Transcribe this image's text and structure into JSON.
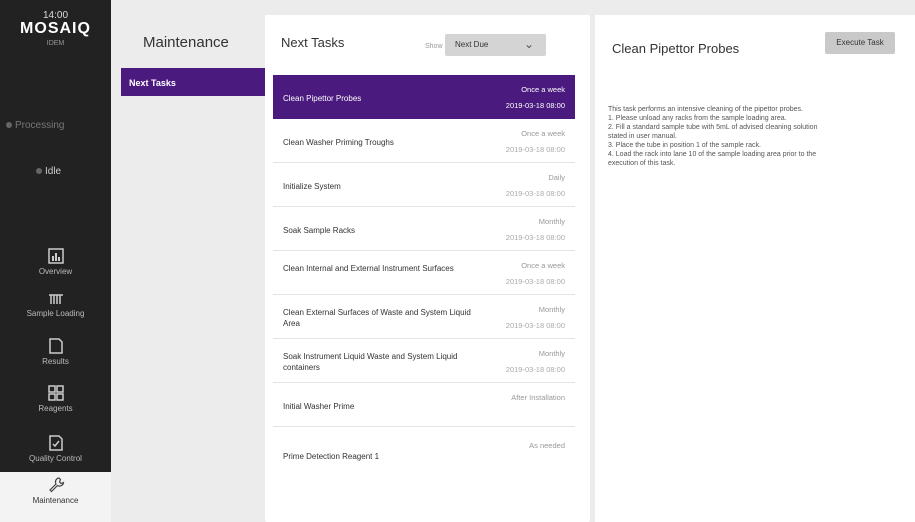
{
  "sidebar": {
    "time": "14:00",
    "logo": "MOSAIQ",
    "logo_sub": "IDEM",
    "status_1": "Processing",
    "status_2": "Idle",
    "items": [
      {
        "label": "Overview",
        "icon": "overview-icon"
      },
      {
        "label": "Sample Loading",
        "icon": "sample-loading-icon"
      },
      {
        "label": "Results",
        "icon": "results-icon"
      },
      {
        "label": "Reagents",
        "icon": "reagents-icon"
      },
      {
        "label": "Quality Control",
        "icon": "quality-control-icon"
      },
      {
        "label": "Maintenance",
        "icon": "wrench-icon"
      }
    ]
  },
  "menu": {
    "title": "Maintenance",
    "items": [
      {
        "label": "Next Tasks"
      }
    ]
  },
  "tasks_panel": {
    "title": "Next Tasks",
    "show_label": "Show",
    "dropdown_value": "Next Due",
    "tasks": [
      {
        "name": "Clean Pipettor Probes",
        "freq": "Once a week",
        "date": "2019-03-18 08:00"
      },
      {
        "name": "Clean Washer Priming Troughs",
        "freq": "Once a week",
        "date": "2019-03-18 08:00"
      },
      {
        "name": "Initialize System",
        "freq": "Daily",
        "date": "2019-03-18 08:00"
      },
      {
        "name": "Soak Sample Racks",
        "freq": "Monthly",
        "date": "2019-03-18 08:00"
      },
      {
        "name": "Clean Internal and External Instrument Surfaces",
        "freq": "Once a week",
        "date": "2019-03-18 08:00"
      },
      {
        "name": "Clean External Surfaces of Waste and System Liquid Area",
        "freq": "Monthly",
        "date": "2019-03-18 08:00"
      },
      {
        "name": "Soak Instrument Liquid Waste and System Liquid containers",
        "freq": "Monthly",
        "date": "2019-03-18 08:00"
      },
      {
        "name": "Initial Washer Prime",
        "freq": "After Installation",
        "date": ""
      },
      {
        "name": "Prime Detection Reagent 1",
        "freq": "As needed",
        "date": ""
      }
    ]
  },
  "detail": {
    "title": "Clean Pipettor Probes",
    "execute_label": "Execute Task",
    "lines": [
      "This task performs an intensive cleaning of the pipettor probes.",
      "1. Please unload any racks from the sample loading area.",
      "2. Fill a standard sample tube with 5mL of advised cleaning solution",
      "stated in user manual.",
      "3. Place the tube in position 1 of the sample rack.",
      "4. Load the rack into lane 10 of the sample loading area prior to the",
      "execution of this task."
    ]
  },
  "colors": {
    "accent": "#4a1a7e",
    "sidebar_bg": "#222222",
    "page_bg": "#ececec"
  }
}
